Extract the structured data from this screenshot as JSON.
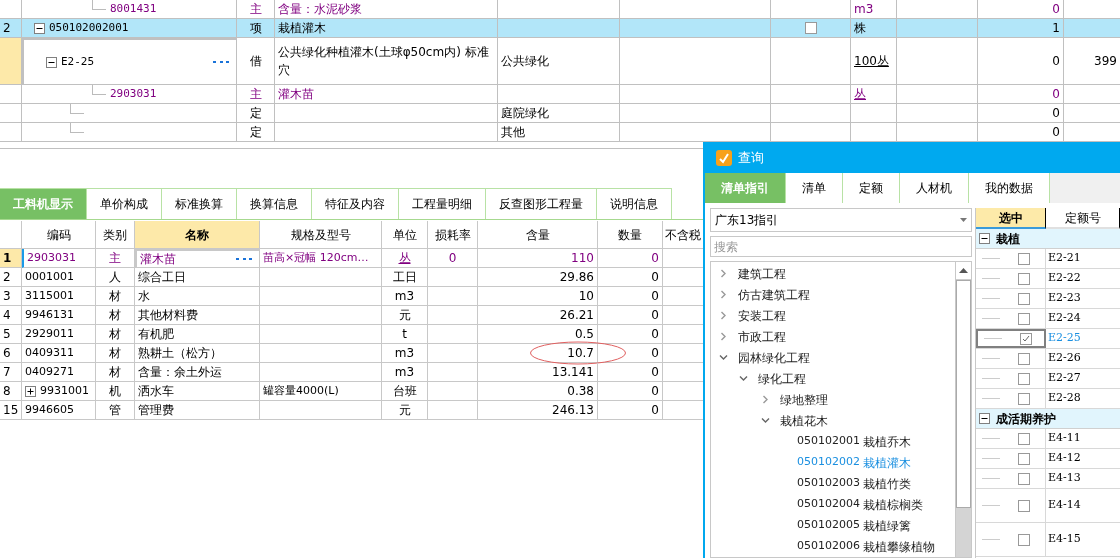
{
  "top_grid": {
    "rows": [
      {
        "kind": "continued",
        "code": "8001431",
        "type": "主",
        "name": "含量：水泥砂浆",
        "unit": "m3",
        "qty": "0",
        "selected": false,
        "focused": false,
        "is_main": true
      },
      {
        "kind": "node",
        "num": "2",
        "code": "050102002001",
        "expanded": true,
        "type": "项",
        "name": "栽植灌木",
        "checkbox": {
          "checked": false
        },
        "unit": "株",
        "qty": "1",
        "selected": true,
        "focused": false,
        "is_main": false,
        "children": [
          {
            "kind": "node",
            "code": "E2-25",
            "expanded": true,
            "type": "借",
            "name": "公共绿化种植灌木(土球φ50cm内) 标准穴",
            "column_4": "公共绿化",
            "unit": "100丛",
            "unit_underlined": true,
            "qty": "0",
            "column_10": "399",
            "selected": false,
            "focused": true,
            "is_main": false,
            "children": [
              {
                "kind": "leaf",
                "code": "2903031",
                "type": "主",
                "name": "灌木苗",
                "unit": "丛",
                "unit_underlined": true,
                "qty": "0",
                "selected": false,
                "focused": false,
                "is_main": true
              }
            ]
          },
          {
            "kind": "leaf",
            "type": "定",
            "column_4": "庭院绿化",
            "qty": "0",
            "selected": false,
            "focused": false,
            "is_main": false
          },
          {
            "kind": "leaf",
            "type": "定",
            "column_4": "其他",
            "qty": "0",
            "selected": false,
            "focused": false,
            "is_main": false
          }
        ]
      }
    ]
  },
  "detail_tabs": [
    {
      "label": "工料机显示",
      "selected": true
    },
    {
      "label": "单价构成",
      "selected": false
    },
    {
      "label": "标准换算",
      "selected": false
    },
    {
      "label": "换算信息",
      "selected": false
    },
    {
      "label": "特征及内容",
      "selected": false
    },
    {
      "label": "工程量明细",
      "selected": false
    },
    {
      "label": "反查图形工程量",
      "selected": false
    },
    {
      "label": "说明信息",
      "selected": false
    }
  ],
  "material_table": {
    "columns": [
      {
        "label": "编码",
        "selected": false
      },
      {
        "label": "类别",
        "selected": false
      },
      {
        "label": "名称",
        "selected": true
      },
      {
        "label": "规格及型号",
        "selected": false
      },
      {
        "label": "单位",
        "selected": false
      },
      {
        "label": "损耗率",
        "selected": false
      },
      {
        "label": "含量",
        "selected": false
      },
      {
        "label": "数量",
        "selected": false
      },
      {
        "label": "不含税",
        "selected": false
      }
    ],
    "rows": [
      {
        "num": "1",
        "code": "2903031",
        "type": "主",
        "name": "灌木苗",
        "spec": "苗高×冠幅 120cm…",
        "unit": "丛",
        "unit_underlined": true,
        "loss": "0",
        "amount": "110",
        "qty": "0",
        "selected": true,
        "is_main": true
      },
      {
        "num": "2",
        "code": "0001001",
        "type": "人",
        "name": "综合工日",
        "unit": "工日",
        "amount": "29.86",
        "qty": "0",
        "selected": false,
        "is_main": false
      },
      {
        "num": "3",
        "code": "3115001",
        "type": "材",
        "name": "水",
        "unit": "m3",
        "amount": "10",
        "qty": "0",
        "selected": false,
        "is_main": false
      },
      {
        "num": "4",
        "code": "9946131",
        "type": "材",
        "name": "其他材料费",
        "unit": "元",
        "amount": "26.21",
        "qty": "0",
        "selected": false,
        "is_main": false
      },
      {
        "num": "5",
        "code": "2929011",
        "type": "材",
        "name": "有机肥",
        "unit": "t",
        "amount": "0.5",
        "qty": "0",
        "selected": false,
        "is_main": false
      },
      {
        "num": "6",
        "code": "0409311",
        "type": "材",
        "name": "熟耕土（松方）",
        "unit": "m3",
        "amount": "10.7",
        "amount_circled": true,
        "qty": "0",
        "selected": false,
        "is_main": false
      },
      {
        "num": "7",
        "code": "0409271",
        "type": "材",
        "name": "含量：余土外运",
        "unit": "m3",
        "amount": "13.141",
        "qty": "0",
        "selected": false,
        "is_main": false
      },
      {
        "num": "8",
        "code": "9931001",
        "expanded": false,
        "type": "机",
        "name": "洒水车",
        "spec": "罐容量4000(L)",
        "unit": "台班",
        "amount": "0.38",
        "qty": "0",
        "selected": false,
        "is_main": false
      },
      {
        "num": "15",
        "code": "9946605",
        "type": "管",
        "name": "管理费",
        "unit": "元",
        "amount": "246.13",
        "qty": "0",
        "selected": false,
        "is_main": false
      }
    ]
  },
  "query_dialog": {
    "title": "查询",
    "tabs": [
      {
        "label": "清单指引",
        "selected": true
      },
      {
        "label": "清单",
        "selected": false
      },
      {
        "label": "定额",
        "selected": false
      },
      {
        "label": "人材机",
        "selected": false
      },
      {
        "label": "我的数据",
        "selected": false
      }
    ],
    "guide_select": {
      "value": "广东13指引"
    },
    "search": {
      "placeholder": "搜索"
    },
    "tree": [
      {
        "label": "建筑工程",
        "expanded": false
      },
      {
        "label": "仿古建筑工程",
        "expanded": false
      },
      {
        "label": "安装工程",
        "expanded": false
      },
      {
        "label": "市政工程",
        "expanded": false
      },
      {
        "label": "园林绿化工程",
        "expanded": true,
        "children": [
          {
            "label": "绿化工程",
            "expanded": true,
            "children": [
              {
                "label": "绿地整理",
                "expanded": false
              },
              {
                "label": "栽植花木",
                "expanded": true,
                "children": [
                  {
                    "code": "050102001",
                    "label": "栽植乔木",
                    "selected": false
                  },
                  {
                    "code": "050102002",
                    "label": "栽植灌木",
                    "selected": true
                  },
                  {
                    "code": "050102003",
                    "label": "栽植竹类",
                    "selected": false
                  },
                  {
                    "code": "050102004",
                    "label": "栽植棕榈类",
                    "selected": false
                  },
                  {
                    "code": "050102005",
                    "label": "栽植绿篱",
                    "selected": false
                  },
                  {
                    "code": "050102006",
                    "label": "栽植攀缘植物",
                    "selected": false
                  }
                ]
              }
            ]
          }
        ]
      }
    ],
    "quota_table": {
      "columns": [
        {
          "label": "选中",
          "selected": true
        },
        {
          "label": "定额号",
          "selected": false
        }
      ],
      "groups": [
        {
          "name": "栽植",
          "expanded": true,
          "items": [
            {
              "code": "E2-21",
              "checked": false,
              "selected": false
            },
            {
              "code": "E2-22",
              "checked": false,
              "selected": false
            },
            {
              "code": "E2-23",
              "checked": false,
              "selected": false
            },
            {
              "code": "E2-24",
              "checked": false,
              "selected": false
            },
            {
              "code": "E2-25",
              "checked": true,
              "selected": true
            },
            {
              "code": "E2-26",
              "checked": false,
              "selected": false
            },
            {
              "code": "E2-27",
              "checked": false,
              "selected": false
            },
            {
              "code": "E2-28",
              "checked": false,
              "selected": false
            }
          ]
        },
        {
          "name": "成活期养护",
          "expanded": true,
          "items": [
            {
              "code": "E4-11",
              "checked": false,
              "selected": false
            },
            {
              "code": "E4-12",
              "checked": false,
              "selected": false
            },
            {
              "code": "E4-13",
              "checked": false,
              "selected": false
            },
            {
              "code": "E4-14",
              "checked": false,
              "selected": false,
              "tall": true
            },
            {
              "code": "E4-15",
              "checked": false,
              "selected": false,
              "tall": true
            }
          ]
        }
      ]
    }
  }
}
